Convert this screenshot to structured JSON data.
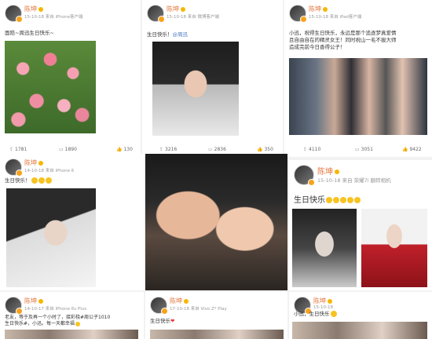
{
  "posts": [
    {
      "user": "陈坤",
      "meta": "15-10-18  来自 iPhone客户端",
      "text": "面陪~周迅生日快乐~",
      "actions": {
        "repost": "1781",
        "comment": "1890",
        "like": "130"
      }
    },
    {
      "user": "陈坤",
      "meta": "15-10-18  来自 微博客户端",
      "text_prefix": "生日快乐！",
      "mention": "@周迅",
      "actions": {
        "repost": "3216",
        "comment": "2836",
        "like": "350"
      }
    },
    {
      "user": "陈坤",
      "meta": "15-10-18  来自 iPad客户端",
      "text_line1": "小迅，祝得生日快乐，永远是那个追逐梦真爱情",
      "text_line2": "且自由自在的精灵女王！同时祝山一毛不拔大师",
      "text_line3": "造成完前今日香得公子！",
      "actions": {
        "repost": "4110",
        "comment": "3051",
        "like": "9422"
      }
    },
    {
      "user": "陈坤",
      "meta": "14-10-18  来自 iPhone 6",
      "text": "生日快乐！"
    },
    {
      "user": "陈坤",
      "meta": "15-10-18  来自 荣耀7i 翻转相机",
      "text": "生日快乐"
    },
    {
      "user": "陈坤",
      "meta": "14-10-17  来自 iPhone 6s Plus",
      "text_line1": "老友，等于及再一个小时了，接彩桡#周公子1010",
      "text_line2": "生日快乐#，小迅。每一天都幸福"
    },
    {
      "user": "陈坤",
      "meta": "17-10-18  来自 Vivo Z* Play",
      "text": "生日快乐"
    },
    {
      "user": "陈坤",
      "meta": "15-10-18",
      "text": "小迅，生日快乐"
    }
  ],
  "icons": {
    "repost": "repost-icon",
    "comment": "comment-icon",
    "like": "thumb-up-icon"
  },
  "colors": {
    "username": "#e4763b",
    "link": "#4a7bc1",
    "background": "#f2f2f2"
  }
}
